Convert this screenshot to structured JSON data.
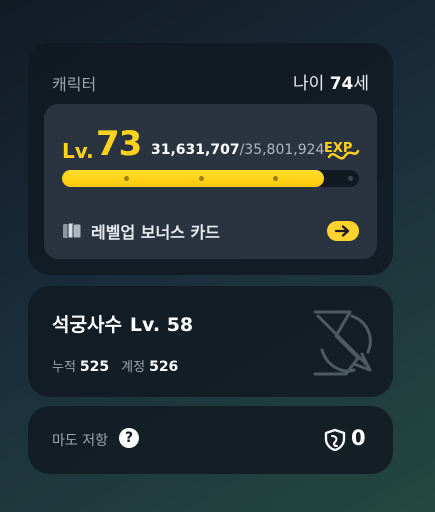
{
  "character": {
    "title": "캐릭터",
    "age_prefix": "나이",
    "age_value": "74",
    "age_suffix": "세",
    "level_prefix": "Lv.",
    "level": "73",
    "exp_current": "31,631,707",
    "exp_separator": "/",
    "exp_max": "35,801,924",
    "exp_icon": "exp-icon",
    "exp_progress": 0.8835,
    "bonus_card_label": "레벨업 보너스 카드",
    "bonus_card_icon": "cards-icon",
    "arrow_icon": "arrow-right-icon"
  },
  "job": {
    "name": "석궁사수",
    "level": "Lv. 58",
    "cumulative_label": "누적",
    "cumulative_value": "525",
    "account_label": "계정",
    "account_value": "526",
    "emblem_icon": "crossbow-emblem-icon"
  },
  "resistance": {
    "label": "마도 저항",
    "help_glyph": "?",
    "icon": "magic-resistance-icon",
    "value": "0"
  },
  "colors": {
    "accent": "#ffd21c",
    "card_bg": "#111a22",
    "inner_bg": "#2a3440",
    "muted_text": "#9ba5ae"
  }
}
